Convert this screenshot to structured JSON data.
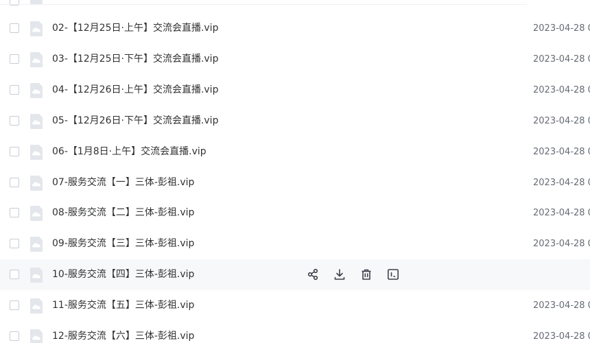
{
  "files": [
    {
      "name": "02-【12月25日·上午】交流会直播.vip",
      "date": "2023-04-28 0",
      "hovered": false
    },
    {
      "name": "03-【12月25日·下午】交流会直播.vip",
      "date": "2023-04-28 0",
      "hovered": false
    },
    {
      "name": "04-【12月26日·上午】交流会直播.vip",
      "date": "2023-04-28 0",
      "hovered": false
    },
    {
      "name": "05-【12月26日·下午】交流会直播.vip",
      "date": "2023-04-28 0",
      "hovered": false
    },
    {
      "name": "06-【1月8日·上午】交流会直播.vip",
      "date": "2023-04-28 0",
      "hovered": false
    },
    {
      "name": "07-服务交流【一】三体-彭祖.vip",
      "date": "2023-04-28 0",
      "hovered": false
    },
    {
      "name": "08-服务交流【二】三体-彭祖.vip",
      "date": "2023-04-28 0",
      "hovered": false
    },
    {
      "name": "09-服务交流【三】三体-彭祖.vip",
      "date": "2023-04-28 0",
      "hovered": false
    },
    {
      "name": "10-服务交流【四】三体-彭祖.vip",
      "date": "",
      "hovered": true
    },
    {
      "name": "11-服务交流【五】三体-彭祖.vip",
      "date": "2023-04-28 0",
      "hovered": false
    },
    {
      "name": "12-服务交流【六】三体-彭祖.vip",
      "date": "2023-04-28 0",
      "hovered": false
    }
  ],
  "row_actions": [
    {
      "name": "share-icon"
    },
    {
      "name": "download-icon"
    },
    {
      "name": "trash-icon"
    },
    {
      "name": "rename-icon"
    }
  ],
  "colors": {
    "hover_bg": "#f7f8fa",
    "icon_fill": "#e3e6ea",
    "icon_glyph": "#ffffff",
    "action_stroke": "#3c4048"
  }
}
